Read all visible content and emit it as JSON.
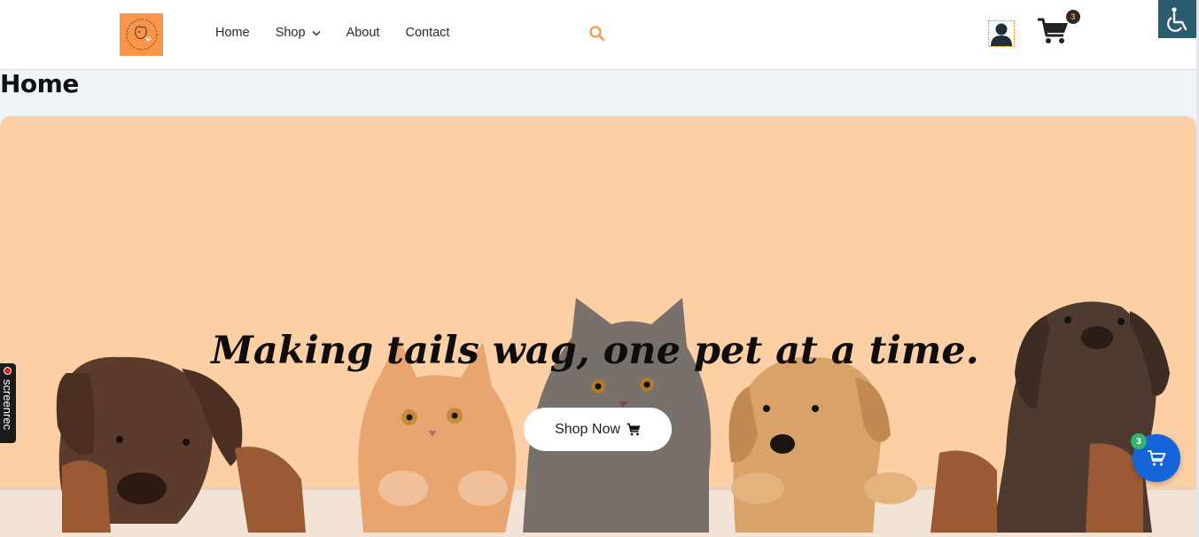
{
  "header": {
    "logo_icon": "paw-dog-logo",
    "nav": [
      {
        "label": "Home"
      },
      {
        "label": "Shop",
        "has_dropdown": true
      },
      {
        "label": "About"
      },
      {
        "label": "Contact"
      }
    ],
    "search_icon": "search-icon",
    "user_icon": "user-icon",
    "cart_icon": "cart-icon",
    "cart_count": "3",
    "accessibility_icon": "wheelchair-icon"
  },
  "page": {
    "title": "Home"
  },
  "hero": {
    "tagline": "Making tails wag, one pet at a time.",
    "cta_label": "Shop Now",
    "cta_icon": "cart-icon",
    "background_color": "#fccfa5"
  },
  "floating_cart": {
    "count": "3",
    "icon": "cart-icon",
    "color": "#1565d8"
  },
  "screenrec": {
    "label": "screenrec"
  },
  "colors": {
    "accent": "#f7954a",
    "header_bg": "#ffffff",
    "page_bg": "#eef3f8"
  }
}
